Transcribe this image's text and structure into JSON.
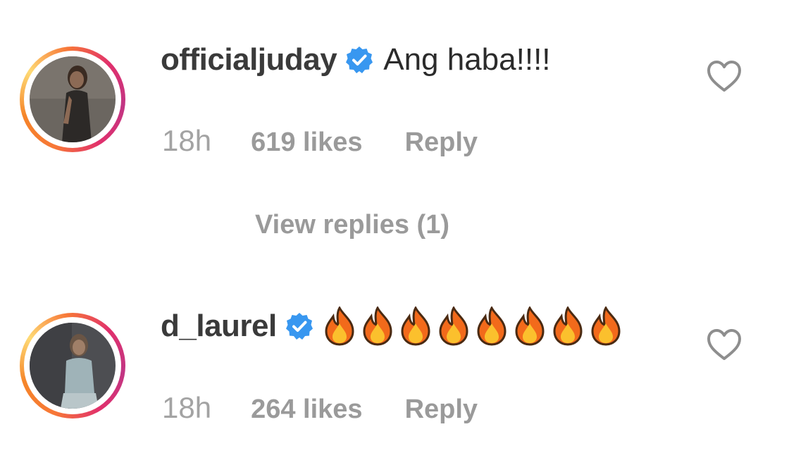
{
  "comments": [
    {
      "username": "officialjuday",
      "verified": true,
      "text": "Ang haba!!!!",
      "time": "18h",
      "likes": "619 likes",
      "reply_label": "Reply",
      "view_replies": "View replies (1)"
    },
    {
      "username": "d_laurel",
      "verified": true,
      "emoji": "🔥🔥🔥🔥🔥🔥🔥🔥",
      "time": "18h",
      "likes": "264 likes",
      "reply_label": "Reply"
    }
  ],
  "icons": {
    "verified": "verified-badge-icon",
    "like": "heart-outline-icon",
    "emoji": "fire-emoji-icon"
  },
  "colors": {
    "verified_blue": "#3897f0",
    "meta_gray": "#9a9a9a",
    "story_ring": [
      "#f58529",
      "#e1306c",
      "#c13584"
    ]
  }
}
